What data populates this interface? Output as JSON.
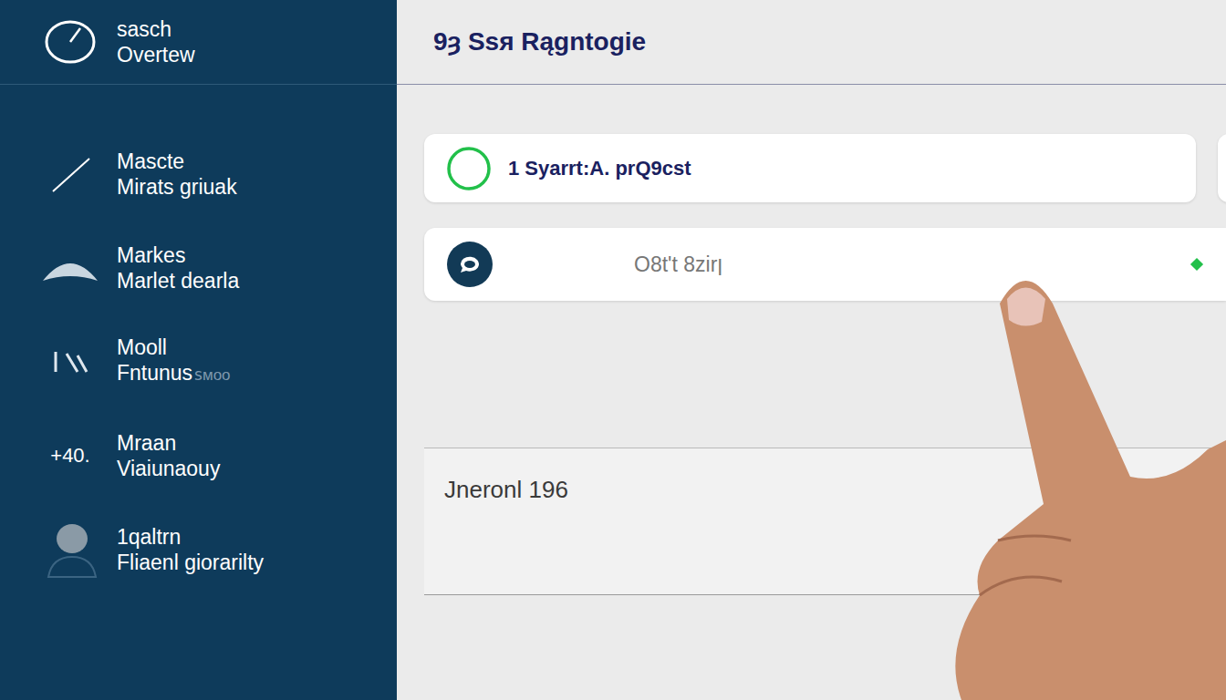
{
  "sidebar": {
    "header": {
      "title": "sasch",
      "subtitle": "Overtew"
    },
    "items": [
      {
        "title": "Mascte",
        "subtitle": "Mirats griuak",
        "kind": "line"
      },
      {
        "title": "Markes",
        "subtitle": "Marlet dearla",
        "kind": "dome"
      },
      {
        "title": "Mooll",
        "subtitle": "Fntunus",
        "faint": "ꜱᴍᴏᴏ",
        "kind": "glyph"
      },
      {
        "title": "Mraan",
        "subtitle": "Viaiunaouy",
        "kind": "text",
        "icon_text": "+40."
      },
      {
        "title": "1qaltrn",
        "subtitle": "Fliaenl giorarilty",
        "kind": "avatar"
      }
    ]
  },
  "main": {
    "title": "9ȝ Ssя Rągntogie",
    "cards": [
      {
        "text": "1 Syarrt:A. prQ9cst",
        "kind": "status"
      },
      {
        "text": "O8t't 8zirן",
        "kind": "chat"
      }
    ],
    "footer": {
      "text": "Jneronl 196"
    }
  }
}
